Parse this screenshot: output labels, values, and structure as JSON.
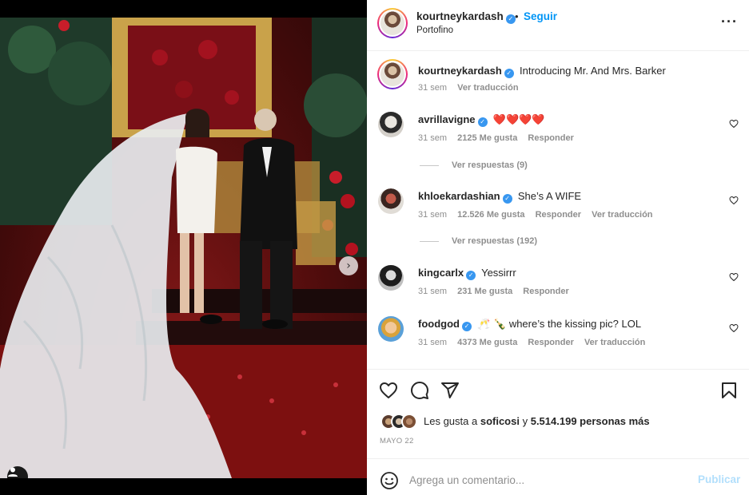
{
  "post": {
    "author": "kourtneykardash",
    "follow_label": "Seguir",
    "location": "Portofino",
    "caption": "Introducing Mr. And Mrs. Barker",
    "caption_time": "31 sem",
    "caption_translate": "Ver traducción"
  },
  "comments": [
    {
      "user": "avrillavigne",
      "text": "❤️❤️❤️❤️",
      "time": "31 sem",
      "likes": "2125 Me gusta",
      "reply": "Responder",
      "replies": "Ver respuestas (9)"
    },
    {
      "user": "khloekardashian",
      "text": "She’s A WIFE",
      "time": "31 sem",
      "likes": "12.526 Me gusta",
      "reply": "Responder",
      "translate": "Ver traducción",
      "replies": "Ver respuestas (192)"
    },
    {
      "user": "kingcarlx",
      "text": "Yessirrr",
      "time": "31 sem",
      "likes": "231 Me gusta",
      "reply": "Responder"
    },
    {
      "user": "foodgod",
      "text": "🥂 🍾 where’s the kissing pic? LOL",
      "time": "31 sem",
      "likes": "4373 Me gusta",
      "reply": "Responder",
      "translate": "Ver traducción"
    }
  ],
  "likes": {
    "prefix": "Les gusta a",
    "user": "soficosi",
    "connector": "y",
    "count": "5.514.199 personas más"
  },
  "date": "MAYO 22",
  "add_comment": {
    "placeholder": "Agrega un comentario...",
    "post_label": "Publicar"
  },
  "icons": {
    "more": "more-options-icon",
    "like": "heart-icon",
    "comment": "comment-icon",
    "share": "send-icon",
    "save": "bookmark-icon",
    "emoji": "smiley-icon",
    "next": "chevron-right-icon",
    "tags": "user-tag-icon"
  },
  "colors": {
    "link": "#0095f6",
    "verified": "#3897f0",
    "muted": "#8e8e8e",
    "heart": "#ed4956"
  }
}
